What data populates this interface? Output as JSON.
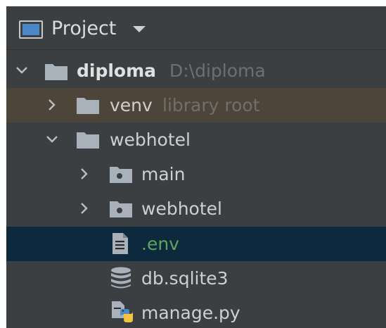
{
  "panel": {
    "title": "Project",
    "title_icon": "project-window-icon"
  },
  "tree": {
    "root": {
      "label": "diploma",
      "path": "D:\\diploma",
      "expanded": true,
      "icon": "folder-icon"
    },
    "venv": {
      "label": "venv",
      "hint": "library root",
      "expanded": false,
      "icon": "folder-icon"
    },
    "webhotel_dir": {
      "label": "webhotel",
      "expanded": true,
      "icon": "folder-icon"
    },
    "main": {
      "label": "main",
      "expanded": false,
      "icon": "package-folder-icon"
    },
    "webhotel_pkg": {
      "label": "webhotel",
      "expanded": false,
      "icon": "package-folder-icon"
    },
    "env_file": {
      "label": ".env",
      "selected": true,
      "icon": "text-file-icon"
    },
    "db_file": {
      "label": "db.sqlite3",
      "icon": "database-icon"
    },
    "manage_file": {
      "label": "manage.py",
      "icon": "python-file-icon"
    }
  },
  "colors": {
    "panel_bg": "#3c3f41",
    "selected_row": "#0d293e",
    "library_row": "#4d4539",
    "modified_file": "#62a35c",
    "hint_text": "#6f6f6f",
    "folder": "#a9b1ba"
  }
}
